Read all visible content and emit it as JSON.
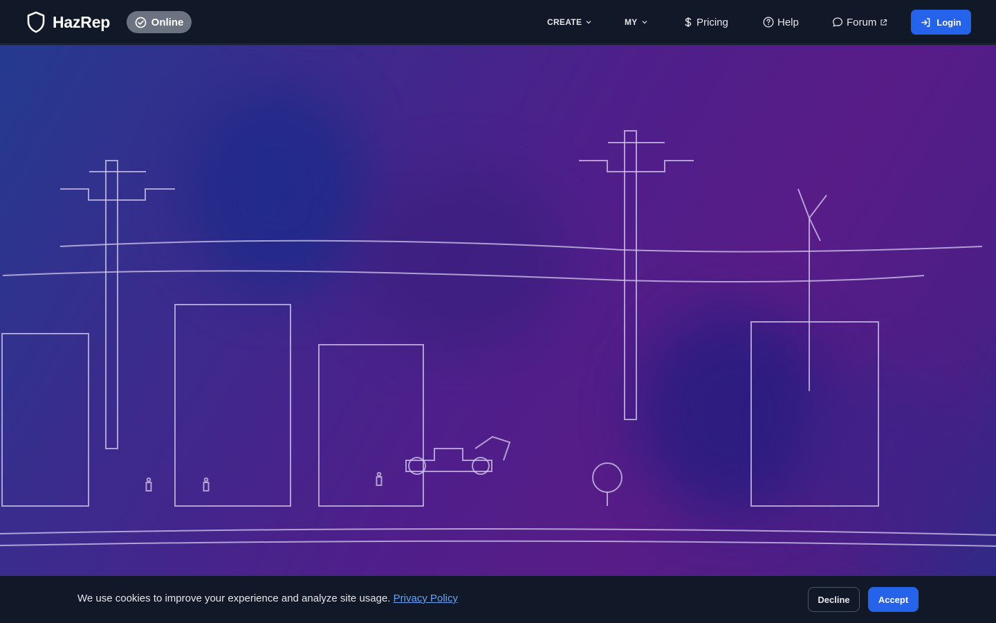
{
  "header": {
    "brand_name": "HazRep",
    "status_label": "Online",
    "nav": {
      "create": "CREATE",
      "my": "MY",
      "pricing": "Pricing",
      "help": "Help",
      "forum": "Forum"
    },
    "login_label": "Login"
  },
  "cookie": {
    "message": "We use cookies to improve your experience and analyze site usage.",
    "link_text": "Privacy Policy",
    "decline_label": "Decline",
    "accept_label": "Accept"
  },
  "colors": {
    "header_bg": "#111827",
    "accent_blue": "#2563eb",
    "link_blue": "#60a5fa",
    "status_pill": "#6b7280"
  }
}
